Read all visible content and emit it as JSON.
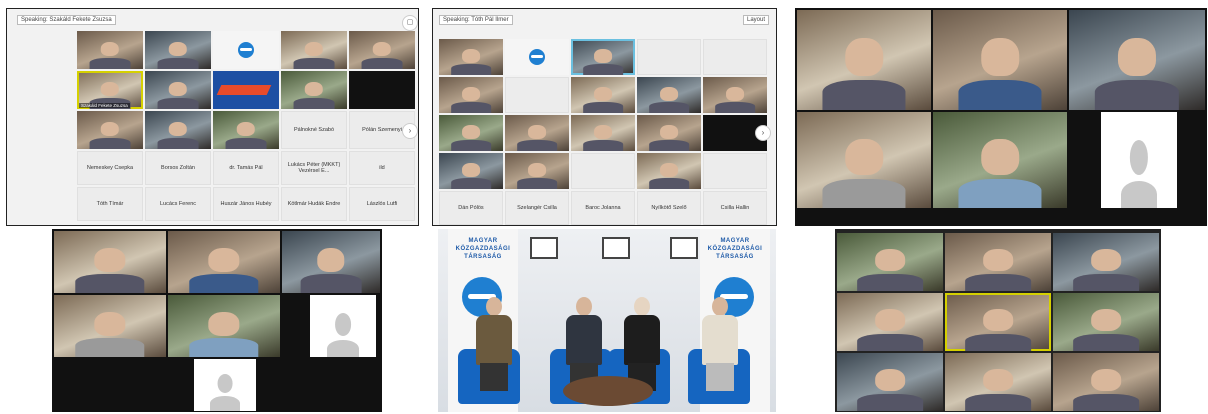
{
  "panel1": {
    "speaking_label": "Speaking: Szakáld Fekete Zsuzsa",
    "highlight_name": "Szakáld Fekete Zsuzsa",
    "row4": [
      "",
      "",
      "",
      "Pálnokné Szabó",
      "Pólán Szemenyi"
    ],
    "row5": [
      "Nemeskey Csepka",
      "Borsos Zoltán",
      "dr. Tamás Pál",
      "Lukács Péter (MKKT) Vezérsel E...",
      "ild"
    ],
    "row6": [
      "Tóth Tímár",
      "Lucács Ferenc",
      "Huszár János Hubéy",
      "Kötlmár Hudák Endre",
      "Lászlós Lutfi"
    ]
  },
  "panel2": {
    "speaking_label": "Speaking: Tóth Pál Ilmer",
    "layout_button": "Layout",
    "bottom_names": [
      "Dán Pólös",
      "Szelangér Csilla",
      "Baroc Jolanna",
      "Nyílkötő Szelő",
      "Csilla Hallin"
    ]
  },
  "panel5": {
    "banner_text": "MAGYAR KÖZGAZDASÁGI TÁRSASÁG"
  },
  "colors": {
    "accent": "#1f7fd1",
    "highlight": "#d5d000",
    "dark_bg": "#111111"
  }
}
